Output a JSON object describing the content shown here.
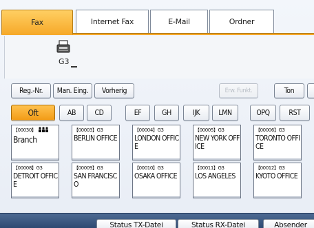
{
  "tabs": [
    {
      "label": "Fax",
      "active": true
    },
    {
      "label": "Internet Fax",
      "active": false
    },
    {
      "label": "E-Mail",
      "active": false
    },
    {
      "label": "Ordner",
      "active": false
    }
  ],
  "display": {
    "icon": "fax-machine-icon",
    "mode": "G3"
  },
  "toolbar": {
    "reg_nr": "Reg.-Nr.",
    "man_eing": "Man. Eing.",
    "vorherig": "Vorherig",
    "erw_funkt": "Erw. Funkt.",
    "ton": "Ton"
  },
  "index_tabs": [
    "Oft",
    "AB",
    "CD",
    "EF",
    "GH",
    "IJK",
    "LMN",
    "OPQ",
    "RST"
  ],
  "destinations": [
    {
      "code": "【00030】",
      "badge": "group-icon",
      "name": "Branch"
    },
    {
      "code": "【00003】G3",
      "name": "BERLIN OFFICE"
    },
    {
      "code": "【00004】G3",
      "name": "LONDON OFFICE"
    },
    {
      "code": "【00005】G3",
      "name": "NEW YORK OFFICE"
    },
    {
      "code": "【00006】G3",
      "name": "TORONTO OFFICE"
    },
    {
      "code": "【00008】G3",
      "name": "DETROIT OFFICE"
    },
    {
      "code": "【00009】G3",
      "name": "SAN FRANCISCO"
    },
    {
      "code": "【00010】G3",
      "name": "OSAKA OFFICE"
    },
    {
      "code": "【00011】G3",
      "name": "LOS ANGELES"
    },
    {
      "code": "【00012】G3",
      "name": "KYOTO OFFICE"
    }
  ],
  "bottom": {
    "status_tx": "Status TX-Datei",
    "status_rx": "Status RX-Datei",
    "absender": "Absender"
  },
  "colors": {
    "accent": "#f6a92a",
    "bottom_bar": "#2e4a72"
  }
}
